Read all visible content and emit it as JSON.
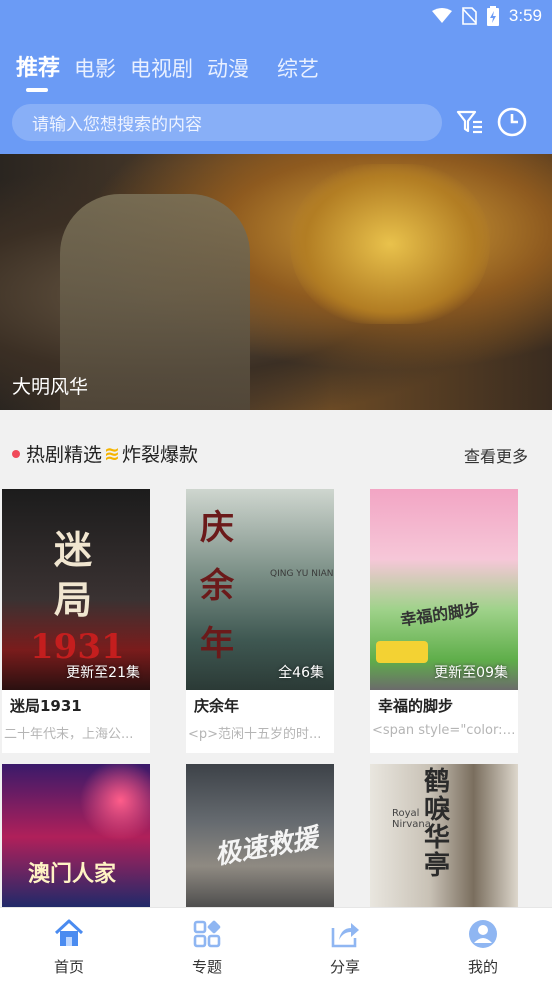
{
  "status": {
    "time": "3:59"
  },
  "tabs": [
    {
      "label": "推荐"
    },
    {
      "label": "电影"
    },
    {
      "label": "电视剧"
    },
    {
      "label": "动漫"
    },
    {
      "label": "综艺"
    }
  ],
  "search": {
    "placeholder": "请输入您想搜索的内容"
  },
  "banner": {
    "title": "大明风华"
  },
  "section": {
    "title": "热剧精选",
    "wave": "≋",
    "subtitle": "炸裂爆款",
    "more": "查看更多"
  },
  "cards": [
    {
      "name": "迷局1931",
      "badge": "更新至21集",
      "desc": "二十年代末，上海公...",
      "poster_text": "迷局",
      "poster_sub": "1931"
    },
    {
      "name": "庆余年",
      "badge": "全46集",
      "desc": "<p>范闲十五岁的时...",
      "poster_text": "庆余年",
      "poster_sub": "QING YU NIAN"
    },
    {
      "name": "幸福的脚步",
      "badge": "更新至09集",
      "desc": "<span style=\"color: r...",
      "poster_text": "幸福的脚步",
      "poster_sub": ""
    },
    {
      "name": "",
      "badge": "",
      "desc": "",
      "poster_text": "澳门人家",
      "poster_sub": ""
    },
    {
      "name": "",
      "badge": "",
      "desc": "",
      "poster_text": "极速救援",
      "poster_sub": ""
    },
    {
      "name": "",
      "badge": "",
      "desc": "",
      "poster_text": "鹤唳华亭",
      "poster_sub": "Royal Nirvana"
    }
  ],
  "nav": [
    {
      "label": "首页",
      "icon": "home-icon",
      "active": true
    },
    {
      "label": "专题",
      "icon": "grid-icon",
      "active": false
    },
    {
      "label": "分享",
      "icon": "share-icon",
      "active": false
    },
    {
      "label": "我的",
      "icon": "user-icon",
      "active": false
    }
  ],
  "colors": {
    "accent": "#6b9bf5",
    "icon": "#8fb6f2"
  }
}
